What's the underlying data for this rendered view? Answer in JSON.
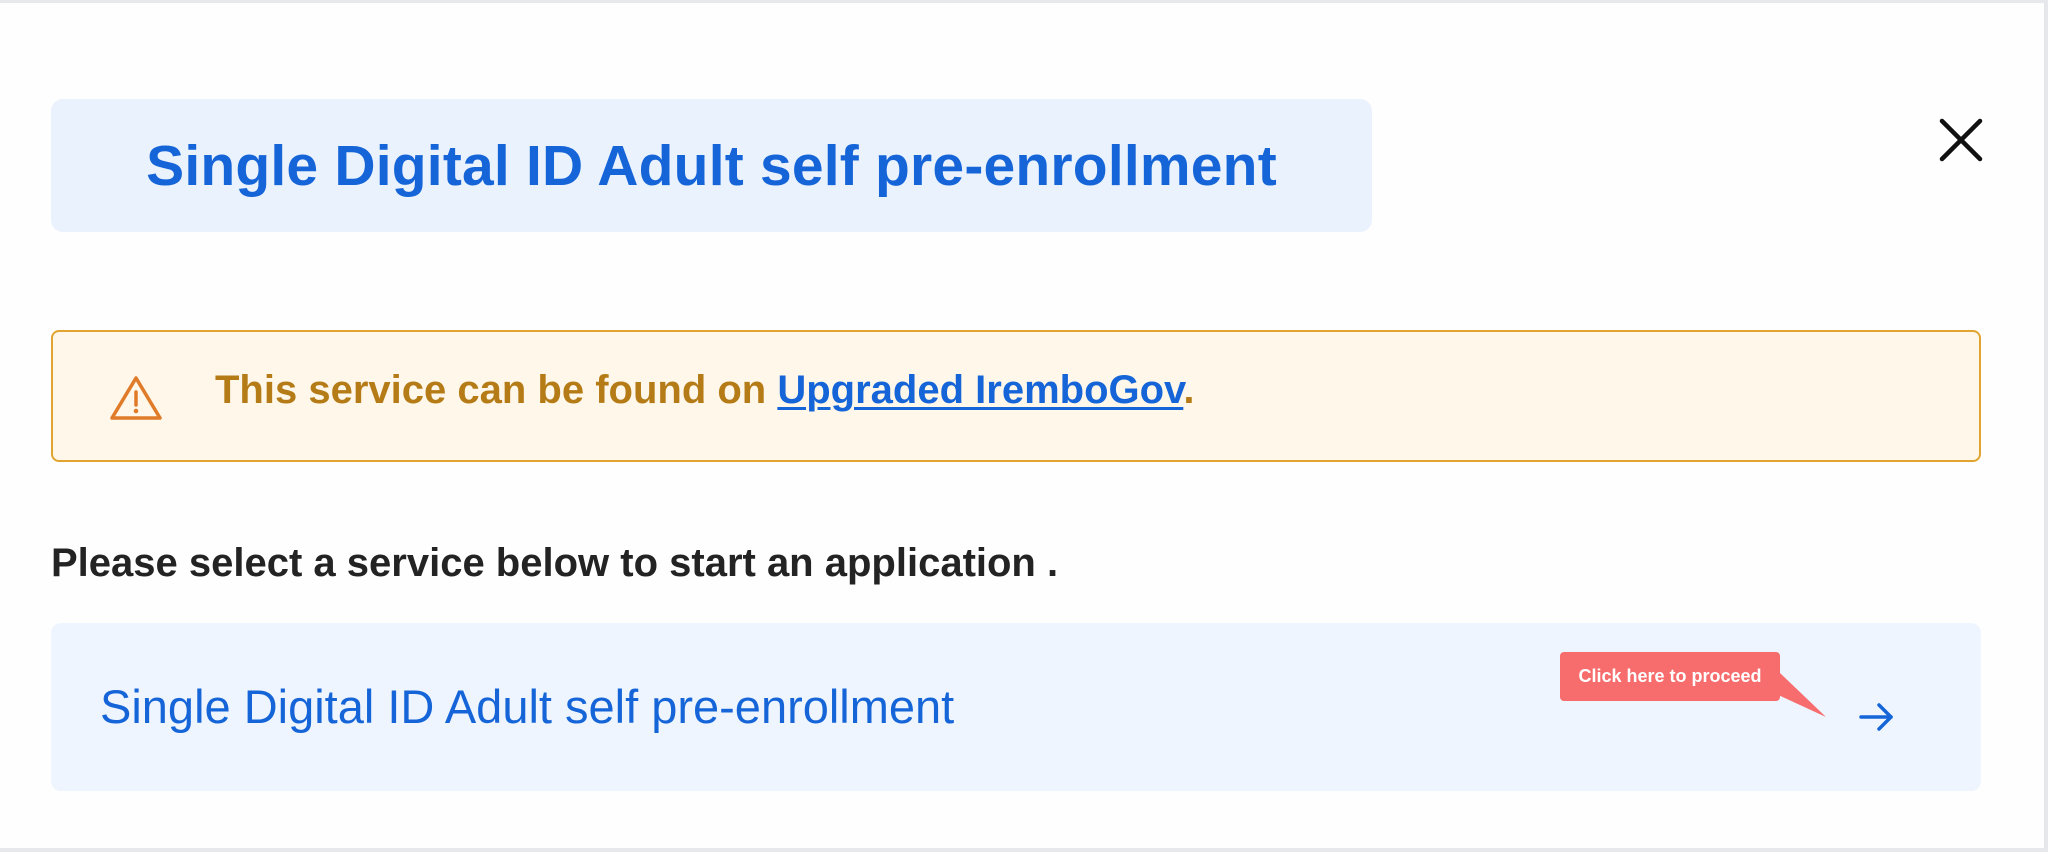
{
  "modal": {
    "title": "Single Digital ID Adult self pre-enrollment",
    "close_icon": "close-icon"
  },
  "alert": {
    "icon": "warning-icon",
    "text_prefix": "This service can be found on ",
    "link_text": "Upgraded IremboGov",
    "text_suffix": ".",
    "colors": {
      "background": "#fff8ea",
      "border": "#e2a42e",
      "text": "#b57b17",
      "link": "#1565d8"
    }
  },
  "instruction": "Please select a service below to start an application .",
  "services": [
    {
      "label": "Single Digital ID Adult self pre-enrollment",
      "icon": "arrow-right-icon"
    }
  ],
  "tooltip": {
    "text": "Click here to proceed",
    "color": "#f76c6c"
  },
  "colors": {
    "accent": "#1565d8",
    "title_background": "#eaf2fd",
    "card_background": "#eef5fe"
  }
}
